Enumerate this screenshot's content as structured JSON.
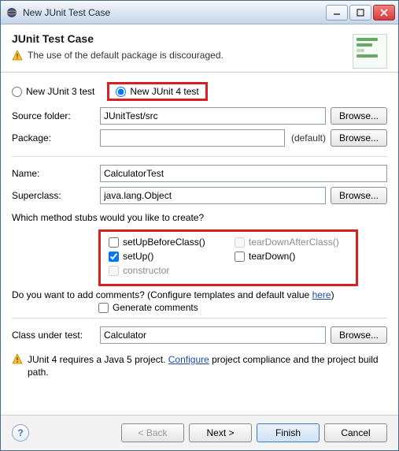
{
  "window": {
    "title": "New JUnit Test Case"
  },
  "header": {
    "heading": "JUnit Test Case",
    "warning": "The use of the default package is discouraged."
  },
  "radios": {
    "junit3": "New JUnit 3 test",
    "junit4": "New JUnit 4 test",
    "selected": "junit4"
  },
  "fields": {
    "source_folder_label": "Source folder:",
    "source_folder_value": "JUnitTest/src",
    "package_label": "Package:",
    "package_value": "",
    "package_suffix": "(default)",
    "name_label": "Name:",
    "name_value": "CalculatorTest",
    "superclass_label": "Superclass:",
    "superclass_value": "java.lang.Object",
    "class_under_test_label": "Class under test:",
    "class_under_test_value": "Calculator",
    "browse_label": "Browse..."
  },
  "stubs": {
    "question": "Which method stubs would you like to create?",
    "setUpBeforeClass": {
      "label": "setUpBeforeClass()",
      "checked": false
    },
    "tearDownAfterClass": {
      "label": "tearDownAfterClass()",
      "checked": false,
      "disabled": true
    },
    "setUp": {
      "label": "setUp()",
      "checked": true
    },
    "tearDown": {
      "label": "tearDown()",
      "checked": false
    },
    "constructor": {
      "label": "constructor",
      "checked": false,
      "disabled": true
    }
  },
  "comments": {
    "question_pre": "Do you want to add comments? (Configure templates and default value ",
    "question_link": "here",
    "question_post": ")",
    "generate_label": "Generate comments",
    "generate_checked": false
  },
  "compliance": {
    "pre": "JUnit 4 requires a Java 5 project. ",
    "link": "Configure",
    "post": " project compliance and the project build path."
  },
  "footer": {
    "back": "< Back",
    "next": "Next >",
    "finish": "Finish",
    "cancel": "Cancel"
  }
}
